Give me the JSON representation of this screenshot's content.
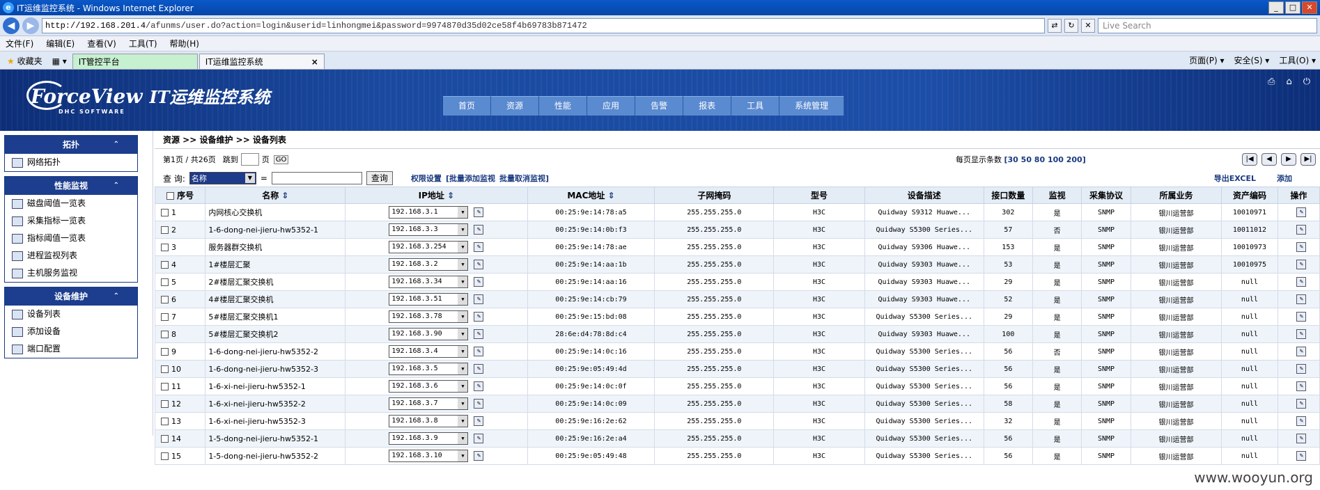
{
  "window": {
    "title": "IT运维监控系统 - Windows Internet Explorer"
  },
  "address": {
    "host": "http://192.168.201.4",
    "path": "/afunms/user.do?action=login&userid=linhongmei&password=9974870d35d02ce58f4b69783b871472",
    "search_placeholder": "Live Search"
  },
  "menu": [
    "文件(F)",
    "编辑(E)",
    "查看(V)",
    "工具(T)",
    "帮助(H)"
  ],
  "tabs": {
    "favorites": "收藏夹",
    "tab1": "IT管控平台",
    "tab2": "IT运维监控系统",
    "tools": [
      "页面(P) ▾",
      "安全(S) ▾",
      "工具(O) ▾"
    ]
  },
  "banner": {
    "logo": "ForceView",
    "logo_sub": "DHC  SOFTWARE",
    "system": "IT运维监控系统",
    "nav": [
      "首页",
      "资源",
      "性能",
      "应用",
      "告警",
      "报表",
      "工具",
      "系统管理"
    ]
  },
  "sidebar": [
    {
      "title": "拓扑",
      "items": [
        "网络拓扑"
      ]
    },
    {
      "title": "性能监视",
      "items": [
        "磁盘阈值一览表",
        "采集指标一览表",
        "指标阈值一览表",
        "进程监视列表",
        "主机服务监视"
      ]
    },
    {
      "title": "设备维护",
      "items": [
        "设备列表",
        "添加设备",
        "端口配置"
      ]
    }
  ],
  "breadcrumb": "资源 >> 设备维护 >> 设备列表",
  "pager": {
    "info": "第1页 / 共26页",
    "jump": "跳到",
    "page": "页",
    "go": "GO",
    "size_label": "每页显示条数",
    "sizes": "[30 50 80 100 200]"
  },
  "query": {
    "label": "查 询:",
    "field": "名称",
    "eq": "=",
    "button": "查询",
    "links": [
      "权限设置",
      "[批量添加监视",
      "批量取消监视]"
    ],
    "export": "导出EXCEL",
    "add": "添加"
  },
  "columns": [
    "序号",
    "名称",
    "IP地址",
    "MAC地址",
    "子网掩码",
    "型号",
    "设备描述",
    "接口数量",
    "监视",
    "采集协议",
    "所属业务",
    "资产编码",
    "操作"
  ],
  "rows": [
    [
      "1",
      "内网核心交换机",
      "192.168.3.1",
      "00:25:9e:14:78:a5",
      "255.255.255.0",
      "H3C",
      "Quidway S9312 Huawe...",
      "302",
      "是",
      "SNMP",
      "银川运营部",
      "10010971"
    ],
    [
      "2",
      "1-6-dong-nei-jieru-hw5352-1",
      "192.168.3.3",
      "00:25:9e:14:0b:f3",
      "255.255.255.0",
      "H3C",
      "Quidway S5300 Series...",
      "57",
      "否",
      "SNMP",
      "银川运营部",
      "10011012"
    ],
    [
      "3",
      "服务器群交换机",
      "192.168.3.254",
      "00:25:9e:14:78:ae",
      "255.255.255.0",
      "H3C",
      "Quidway S9306 Huawe...",
      "153",
      "是",
      "SNMP",
      "银川运营部",
      "10010973"
    ],
    [
      "4",
      "1#楼层汇聚",
      "192.168.3.2",
      "00:25:9e:14:aa:1b",
      "255.255.255.0",
      "H3C",
      "Quidway S9303 Huawe...",
      "53",
      "是",
      "SNMP",
      "银川运营部",
      "10010975"
    ],
    [
      "5",
      "2#楼层汇聚交换机",
      "192.168.3.34",
      "00:25:9e:14:aa:16",
      "255.255.255.0",
      "H3C",
      "Quidway S9303 Huawe...",
      "29",
      "是",
      "SNMP",
      "银川运营部",
      "null"
    ],
    [
      "6",
      "4#楼层汇聚交换机",
      "192.168.3.51",
      "00:25:9e:14:cb:79",
      "255.255.255.0",
      "H3C",
      "Quidway S9303 Huawe...",
      "52",
      "是",
      "SNMP",
      "银川运营部",
      "null"
    ],
    [
      "7",
      "5#楼层汇聚交换机1",
      "192.168.3.78",
      "00:25:9e:15:bd:08",
      "255.255.255.0",
      "H3C",
      "Quidway S5300 Series...",
      "29",
      "是",
      "SNMP",
      "银川运营部",
      "null"
    ],
    [
      "8",
      "5#楼层汇聚交换机2",
      "192.168.3.90",
      "28:6e:d4:78:8d:c4",
      "255.255.255.0",
      "H3C",
      "Quidway S9303 Huawe...",
      "100",
      "是",
      "SNMP",
      "银川运营部",
      "null"
    ],
    [
      "9",
      "1-6-dong-nei-jieru-hw5352-2",
      "192.168.3.4",
      "00:25:9e:14:0c:16",
      "255.255.255.0",
      "H3C",
      "Quidway S5300 Series...",
      "56",
      "否",
      "SNMP",
      "银川运营部",
      "null"
    ],
    [
      "10",
      "1-6-dong-nei-jieru-hw5352-3",
      "192.168.3.5",
      "00:25:9e:05:49:4d",
      "255.255.255.0",
      "H3C",
      "Quidway S5300 Series...",
      "56",
      "是",
      "SNMP",
      "银川运营部",
      "null"
    ],
    [
      "11",
      "1-6-xi-nei-jieru-hw5352-1",
      "192.168.3.6",
      "00:25:9e:14:0c:0f",
      "255.255.255.0",
      "H3C",
      "Quidway S5300 Series...",
      "56",
      "是",
      "SNMP",
      "银川运营部",
      "null"
    ],
    [
      "12",
      "1-6-xi-nei-jieru-hw5352-2",
      "192.168.3.7",
      "00:25:9e:14:0c:09",
      "255.255.255.0",
      "H3C",
      "Quidway S5300 Series...",
      "58",
      "是",
      "SNMP",
      "银川运营部",
      "null"
    ],
    [
      "13",
      "1-6-xi-nei-jieru-hw5352-3",
      "192.168.3.8",
      "00:25:9e:16:2e:62",
      "255.255.255.0",
      "H3C",
      "Quidway S5300 Series...",
      "32",
      "是",
      "SNMP",
      "银川运营部",
      "null"
    ],
    [
      "14",
      "1-5-dong-nei-jieru-hw5352-1",
      "192.168.3.9",
      "00:25:9e:16:2e:a4",
      "255.255.255.0",
      "H3C",
      "Quidway S5300 Series...",
      "56",
      "是",
      "SNMP",
      "银川运营部",
      "null"
    ],
    [
      "15",
      "1-5-dong-nei-jieru-hw5352-2",
      "192.168.3.10",
      "00:25:9e:05:49:48",
      "255.255.255.0",
      "H3C",
      "Quidway S5300 Series...",
      "56",
      "是",
      "SNMP",
      "银川运营部",
      "null"
    ]
  ],
  "watermark": "www.wooyun.org"
}
